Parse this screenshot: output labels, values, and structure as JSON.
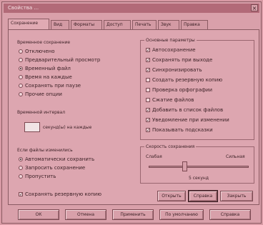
{
  "window": {
    "title": "Свойства ...",
    "close": "×"
  },
  "tabs": [
    "Сохранение",
    "Вид",
    "Форматы",
    "Доступ",
    "Печать",
    "Звук",
    "Правка"
  ],
  "left": {
    "radio_group_title": "Временное сохранение",
    "radio_items": [
      {
        "label": "Отключено",
        "selected": false
      },
      {
        "label": "Предварительный просмотр",
        "selected": false
      },
      {
        "label": "Временный файл",
        "selected": true
      },
      {
        "label": "Время на каждые",
        "selected": false
      },
      {
        "label": "Сохранять при паузе",
        "selected": false
      },
      {
        "label": "Прочие опции",
        "selected": false
      }
    ],
    "interval_title": "Временной интервал",
    "interval_value": "",
    "interval_suffix": "секунд(ы) на каждые",
    "group2_title": "Если файлы изменились",
    "radio_items2": [
      {
        "label": "Автоматически сохранить",
        "selected": true
      },
      {
        "label": "Запросить сохранение",
        "selected": false
      },
      {
        "label": "Пропустить",
        "selected": false
      }
    ],
    "bottom_check": {
      "label": "Сохранять резервную копию",
      "checked": true
    }
  },
  "right": {
    "group_title": "Основные параметры",
    "checks": [
      {
        "label": "Автосохранение",
        "checked": true
      },
      {
        "label": "Сохранять при выходе",
        "checked": true
      },
      {
        "label": "Синхронизировать",
        "checked": true
      },
      {
        "label": "Создать резервную копию",
        "checked": false
      },
      {
        "label": "Проверка орфографии",
        "checked": false
      },
      {
        "label": "Сжатие файлов",
        "checked": false
      },
      {
        "label": "Добавить в список файлов",
        "checked": true
      },
      {
        "label": "Уведомление при изменении",
        "checked": true
      },
      {
        "label": "Показывать подсказки",
        "checked": true
      }
    ],
    "slider_title": "Скорость сохранения",
    "slider_left": "Слабая",
    "slider_right": "Сильная",
    "slider_value_pct": 35,
    "slider_caption": "5 секунд",
    "buttons": [
      "Открыть",
      "Справка",
      "Закрыть"
    ]
  },
  "footer_buttons": [
    "ОК",
    "Отмена",
    "Применить",
    "По умолчанию",
    "Справка"
  ]
}
